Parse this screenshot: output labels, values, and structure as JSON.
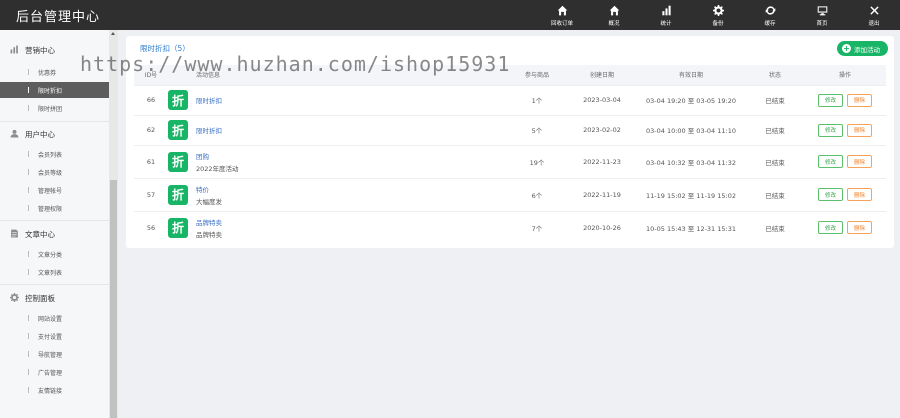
{
  "app": {
    "title": "后台管理中心"
  },
  "topnav": [
    {
      "label": "回收订单",
      "icon": "home-icon"
    },
    {
      "label": "概况",
      "icon": "home-icon"
    },
    {
      "label": "统计",
      "icon": "bar-chart-icon"
    },
    {
      "label": "备份",
      "icon": "gear-icon"
    },
    {
      "label": "缓存",
      "icon": "refresh-icon"
    },
    {
      "label": "首页",
      "icon": "monitor-icon"
    },
    {
      "label": "退出",
      "icon": "close-icon"
    }
  ],
  "sidebar": {
    "groups": [
      {
        "title": "营销中心",
        "icon": "bar-chart-icon",
        "items": [
          {
            "label": "优惠券"
          },
          {
            "label": "限时折扣",
            "active": true
          },
          {
            "label": "限时拼团"
          }
        ]
      },
      {
        "title": "用户中心",
        "icon": "user-icon",
        "items": [
          {
            "label": "会员列表"
          },
          {
            "label": "会员等级"
          },
          {
            "label": "管理帐号"
          },
          {
            "label": "管理权限"
          }
        ]
      },
      {
        "title": "文章中心",
        "icon": "document-icon",
        "items": [
          {
            "label": "文章分类"
          },
          {
            "label": "文章列表"
          }
        ]
      },
      {
        "title": "控制面板",
        "icon": "gear-icon",
        "items": [
          {
            "label": "网站设置"
          },
          {
            "label": "支付设置"
          },
          {
            "label": "导航管理"
          },
          {
            "label": "广告管理"
          },
          {
            "label": "友情链接"
          }
        ]
      }
    ]
  },
  "main": {
    "title": "限时折扣（5）",
    "add_button": "添加活动",
    "watermark": "https://www.huzhan.com/ishop15931",
    "columns": [
      "ID号",
      "活动信息",
      "参与商品",
      "创建日期",
      "有效日期",
      "状态",
      "操作"
    ],
    "badge_char": "折",
    "edit_label": "修改",
    "delete_label": "删除",
    "rows": [
      {
        "id": "66",
        "name": "限时折扣",
        "desc": "",
        "goods": "1个",
        "created": "2023-03-04",
        "valid": "03-04 19:20 至 03-05 19:20",
        "status": "已结束"
      },
      {
        "id": "62",
        "name": "限时折扣",
        "desc": "",
        "goods": "5个",
        "created": "2023-02-02",
        "valid": "03-04 10:00 至 03-04 11:10",
        "status": "已结束"
      },
      {
        "id": "61",
        "name": "团购",
        "desc": "2022年度活动",
        "goods": "19个",
        "created": "2022-11-23",
        "valid": "03-04 10:32 至 03-04 11:32",
        "status": "已结束"
      },
      {
        "id": "57",
        "name": "特价",
        "desc": "大幅度发",
        "goods": "6个",
        "created": "2022-11-19",
        "valid": "11-19 15:02 至 11-19 15:02",
        "status": "已结束"
      },
      {
        "id": "56",
        "name": "品牌特卖",
        "desc": "品牌特卖",
        "goods": "7个",
        "created": "2020-10-26",
        "valid": "10-05 15:43 至 12-31 15:31",
        "status": "已结束"
      }
    ]
  }
}
